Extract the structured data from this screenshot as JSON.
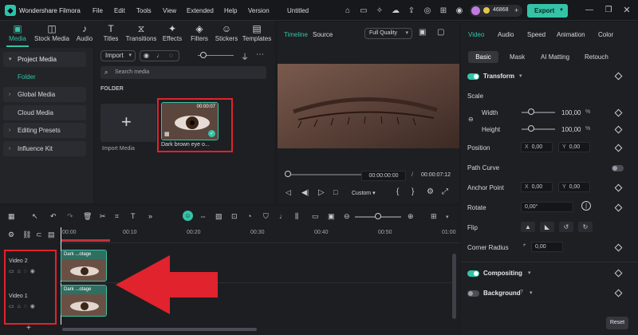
{
  "app": {
    "name": "Wondershare Filmora",
    "menu": [
      "File",
      "Edit",
      "Tools",
      "View",
      "Extended",
      "Help",
      "Version"
    ],
    "project_title": "Untitled",
    "credits": "46868",
    "export_label": "Export"
  },
  "toolbar": {
    "tabs": [
      {
        "label": "Media",
        "icon": "media-icon"
      },
      {
        "label": "Stock Media",
        "icon": "stock-media-icon"
      },
      {
        "label": "Audio",
        "icon": "audio-icon"
      },
      {
        "label": "Titles",
        "icon": "titles-icon"
      },
      {
        "label": "Transitions",
        "icon": "transitions-icon"
      },
      {
        "label": "Effects",
        "icon": "effects-icon"
      },
      {
        "label": "Filters",
        "icon": "filters-icon"
      },
      {
        "label": "Stickers",
        "icon": "stickers-icon"
      },
      {
        "label": "Templates",
        "icon": "templates-icon"
      }
    ],
    "active": "Media"
  },
  "sidebar": {
    "items": [
      "Project Media",
      "Folder",
      "Global Media",
      "Cloud Media",
      "Editing Presets",
      "Influence Kit"
    ]
  },
  "media": {
    "import_label": "Import",
    "search_placeholder": "Search media",
    "folder_heading": "FOLDER",
    "import_tile_label": "Import Media",
    "clip": {
      "name": "Dark brown eye o...",
      "duration": "00:00:07"
    }
  },
  "preview": {
    "tabs": [
      "Timeline",
      "Source"
    ],
    "quality": "Full Quality",
    "current_time": "00:00:00:00",
    "separator": "/",
    "total_time": "00:00:07:12",
    "custom_label": "Custom"
  },
  "inspector": {
    "tabs": [
      "Video",
      "Audio",
      "Speed",
      "Animation",
      "Color"
    ],
    "subtabs": [
      "Basic",
      "Mask",
      "AI Matting",
      "Retouch"
    ],
    "transform": "Transform",
    "scale": "Scale",
    "width_label": "Width",
    "width_value": "100,00",
    "height_label": "Height",
    "height_value": "100,00",
    "percent": "%",
    "position": "Position",
    "x_label": "X",
    "y_label": "Y",
    "pos_x": "0,00",
    "pos_y": "0,00",
    "curved": "Path Curve",
    "anchor": "Anchor Point",
    "anchor_x": "0,00",
    "anchor_y": "0,00",
    "rotate": "Rotate",
    "rotate_value": "0,00°",
    "flip": "Flip",
    "corner": "Corner Radius",
    "corner_value": "0,00",
    "compositing": "Compositing",
    "background": "Background",
    "reset": "Reset"
  },
  "timeline": {
    "ruler": [
      "00:00",
      "00:10",
      "00:20",
      "00:30",
      "00:40",
      "00:50",
      "01:00"
    ],
    "tracks": [
      {
        "name": "Video 2",
        "clip": "Dark ...otage"
      },
      {
        "name": "Video 1",
        "clip": "Dark ...otage"
      }
    ]
  },
  "colors": {
    "accent": "#34c3a6",
    "highlight": "#e0232d"
  }
}
